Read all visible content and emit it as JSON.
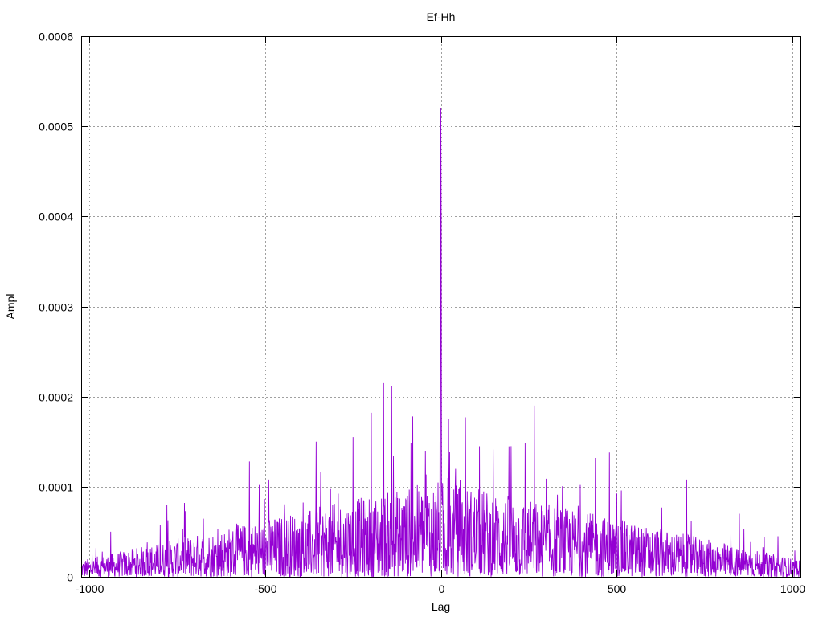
{
  "chart_data": {
    "type": "line",
    "title": "Ef-Hh",
    "xlabel": "Lag",
    "ylabel": "Ampl",
    "xlim": [
      -1024,
      1024
    ],
    "ylim": [
      0,
      0.0006
    ],
    "x_ticks": [
      -1000,
      -500,
      0,
      500,
      1000
    ],
    "x_tick_labels": [
      "-1000",
      "-500",
      "0",
      "500",
      "1000"
    ],
    "y_ticks": [
      0,
      0.0001,
      0.0002,
      0.0003,
      0.0004,
      0.0005,
      0.0006
    ],
    "y_tick_labels": [
      "0",
      "0.0001",
      "0.0002",
      "0.0003",
      "0.0004",
      "0.0005",
      "0.0006"
    ],
    "grid": true,
    "series_color": "#9400d3",
    "series": [
      {
        "name": "",
        "peaks": [
          {
            "x": 0,
            "y": 0.00052
          },
          {
            "x": 1,
            "y": 0.0004
          },
          {
            "x": -2,
            "y": 0.000265
          },
          {
            "x": -163,
            "y": 0.000215
          },
          {
            "x": -140,
            "y": 0.000212
          },
          {
            "x": 266,
            "y": 0.00019
          },
          {
            "x": -198,
            "y": 0.000182
          },
          {
            "x": -80,
            "y": 0.000178
          },
          {
            "x": 70,
            "y": 0.000177
          },
          {
            "x": 22,
            "y": 0.000175
          },
          {
            "x": -250,
            "y": 0.000155
          },
          {
            "x": -355,
            "y": 0.00015
          },
          {
            "x": 240,
            "y": 0.000148
          },
          {
            "x": 200,
            "y": 0.000145
          },
          {
            "x": -44,
            "y": 0.00014
          },
          {
            "x": 480,
            "y": 0.000138
          },
          {
            "x": 440,
            "y": 0.000132
          },
          {
            "x": -545,
            "y": 0.000128
          },
          {
            "x": -490,
            "y": 0.000108
          },
          {
            "x": 700,
            "y": 0.000108
          },
          {
            "x": -780,
            "y": 8e-05
          },
          {
            "x": -730,
            "y": 8.2e-05
          },
          {
            "x": 850,
            "y": 7e-05
          },
          {
            "x": -940,
            "y": 5e-05
          },
          {
            "x": 960,
            "y": 4.5e-05
          }
        ]
      }
    ]
  }
}
